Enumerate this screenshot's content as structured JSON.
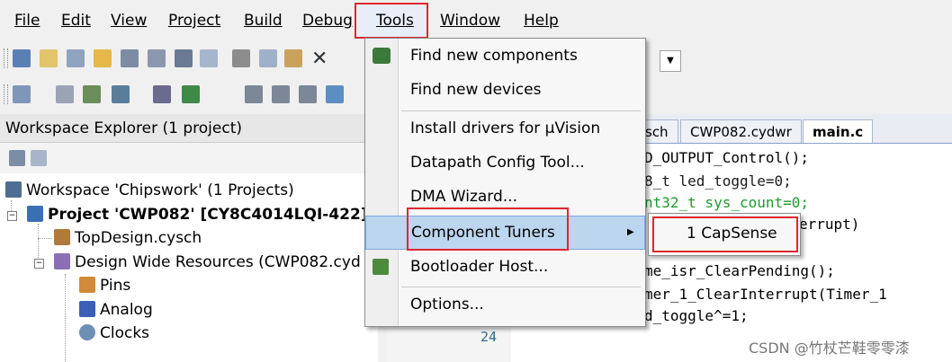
{
  "menubar": {
    "items": [
      "File",
      "Edit",
      "View",
      "Project",
      "Build",
      "Debug",
      "Tools",
      "Window",
      "Help"
    ]
  },
  "workspace": {
    "title": "Workspace Explorer (1 project)",
    "root": "Workspace 'Chipswork' (1 Projects)",
    "project": "Project  'CWP082' [CY8C4014LQI-422]",
    "items": [
      "TopDesign.cysch",
      "Design Wide Resources (CWP082.cyd",
      "Pins",
      "Analog",
      "Clocks"
    ]
  },
  "editor": {
    "tabs": [
      "sch",
      "CWP082.cydwr",
      "main.c"
    ],
    "code_lines": [
      "D_OUTPUT_Control();",
      "8_t led_toggle=0;",
      "nt32_t sys_count=0;",
      "errupt)",
      "me_isr_ClearPending();",
      "mer_1_ClearInterrupt(Timer_1",
      "d_toggle^=1;"
    ],
    "line_number": "24"
  },
  "tools_menu": {
    "items": [
      "Find new components",
      "Find new devices",
      "Install drivers for µVision",
      "Datapath Config Tool...",
      "DMA Wizard...",
      "Component Tuners",
      "Bootloader Host...",
      "Options..."
    ],
    "submenu_item": "1 CapSense"
  },
  "watermark": "CSDN @竹杖芒鞋零零漆",
  "colors": {
    "highlight": "#e0262f",
    "selection": "#bcd6f0"
  }
}
